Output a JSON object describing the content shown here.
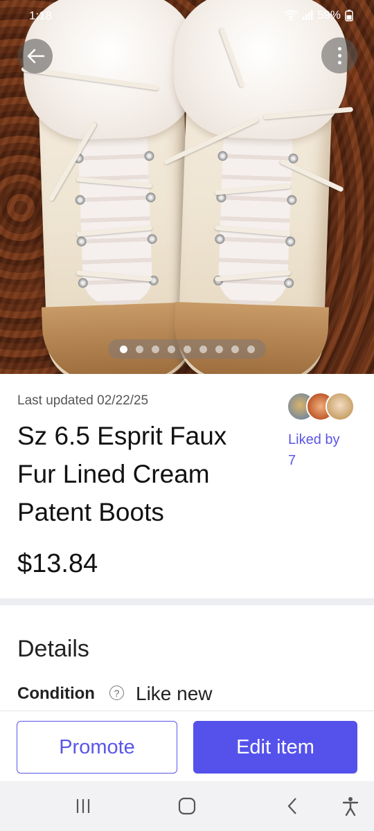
{
  "status_bar": {
    "time": "1:18",
    "battery": "59%"
  },
  "gallery": {
    "image_count": 9,
    "active_index": 0
  },
  "listing": {
    "last_updated": "Last updated 02/22/25",
    "title": "Sz 6.5 Esprit Faux Fur Lined Cream Patent Boots",
    "price": "$13.84",
    "liked_by_label": "Liked by",
    "liked_by_count": "7"
  },
  "details": {
    "heading": "Details",
    "condition_label": "Condition",
    "condition_value": "Like new"
  },
  "actions": {
    "promote_label": "Promote",
    "edit_label": "Edit item"
  },
  "colors": {
    "accent": "#5552ec",
    "link": "#5a55e8"
  },
  "icons": [
    "back-arrow-icon",
    "more-vert-icon",
    "help-icon",
    "recent-apps-icon",
    "home-icon",
    "nav-back-icon",
    "accessibility-icon"
  ]
}
